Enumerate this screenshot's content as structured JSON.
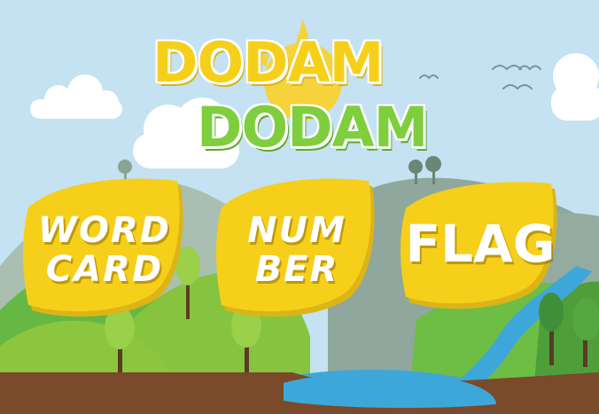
{
  "title": {
    "line1": "DODAM",
    "line2": "DODAM"
  },
  "menu": [
    {
      "id": "word-card",
      "line1": "WORD",
      "line2": "CARD"
    },
    {
      "id": "number",
      "line1": "NUM",
      "line2": "BER"
    },
    {
      "id": "flag",
      "line1": "FLAG"
    }
  ],
  "colors": {
    "sky": "#c4e2f1",
    "leaf_yellow": "#f6cf1b",
    "title_green": "#7fce3e",
    "ground": "#7a4a2a"
  }
}
